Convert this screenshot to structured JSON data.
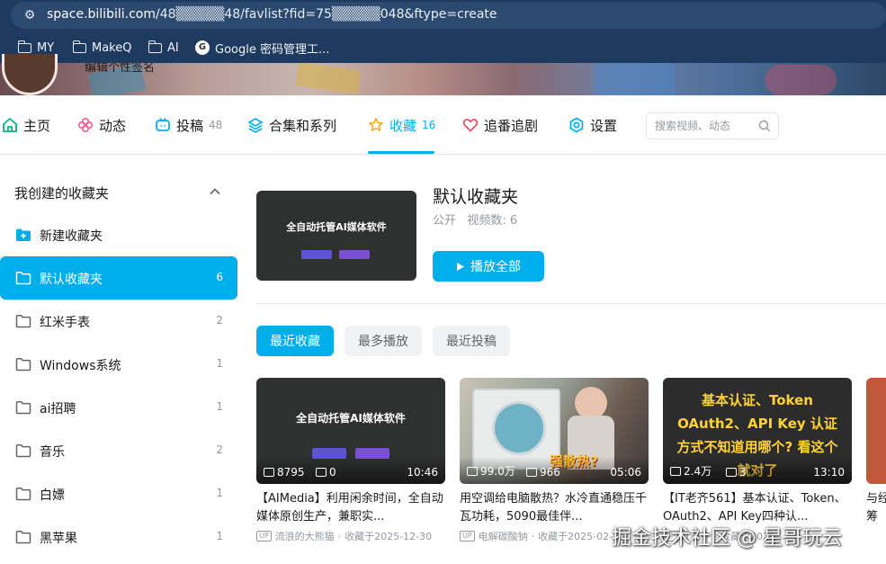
{
  "browser": {
    "url_domain": "space.bilibili.com",
    "url_path": "/48▒▒▒▒▒48/favlist?fid=75▒▒▒▒▒048&ftype=create",
    "bookmarks": [
      {
        "label": "MY",
        "icon": "folder-icon"
      },
      {
        "label": "MakeQ",
        "icon": "folder-icon"
      },
      {
        "label": "AI",
        "icon": "folder-icon"
      },
      {
        "label": "Google 密码管理工...",
        "icon": "google-icon"
      }
    ]
  },
  "profile": {
    "signature": "编辑个性签名"
  },
  "nav": {
    "items": [
      {
        "label": "主页",
        "count": "",
        "icon": "home-icon"
      },
      {
        "label": "动态",
        "count": "",
        "icon": "pinwheel-icon"
      },
      {
        "label": "投稿",
        "count": "48",
        "icon": "tv-icon"
      },
      {
        "label": "合集和系列",
        "count": "",
        "icon": "layers-icon"
      },
      {
        "label": "收藏",
        "count": "16",
        "icon": "star-icon"
      },
      {
        "label": "追番追剧",
        "count": "",
        "icon": "heart-icon"
      },
      {
        "label": "设置",
        "count": "",
        "icon": "gear-icon"
      }
    ],
    "active": "收藏",
    "search_placeholder": "搜索视频、动态"
  },
  "sidebar": {
    "heading": "我创建的收藏夹",
    "new_folder": "新建收藏夹",
    "folders": [
      {
        "label": "默认收藏夹",
        "count": "6",
        "active": true
      },
      {
        "label": "红米手表",
        "count": "2"
      },
      {
        "label": "Windows系统",
        "count": "1"
      },
      {
        "label": "ai招聘",
        "count": "1"
      },
      {
        "label": "音乐",
        "count": "2"
      },
      {
        "label": "白嫖",
        "count": "1"
      },
      {
        "label": "黑苹果",
        "count": "1"
      }
    ]
  },
  "favlist": {
    "title": "默认收藏夹",
    "visibility": "公开",
    "video_count_label": "视频数: 6",
    "play_all": "播放全部",
    "cover_text": "全自动托管AI媒体软件"
  },
  "tabs": [
    "最近收藏",
    "最多播放",
    "最近投稿"
  ],
  "videos": [
    {
      "thumb_text": "全自动托管AI媒体软件",
      "plays": "8795",
      "danmaku": "0",
      "duration": "10:46",
      "title": "【AIMedia】利用闲余时间，全自动媒体原创生产，兼职实...",
      "up_name": "流浪的大熊猫",
      "fav_time": "收藏于2025-12-30"
    },
    {
      "thumb_text": "强散热?",
      "plays": "99.0万",
      "danmaku": "966",
      "duration": "05:06",
      "title": "用空调给电脑散热？水冷直通稳压千瓦功耗，5090最佳伴...",
      "up_name": "电解碳酸钠",
      "fav_time": "收藏于2025-02-..."
    },
    {
      "thumb_text": "基本认证、Token OAuth2、API Key 认证方式不知道用哪个? 看这个就对了",
      "plays": "2.4万",
      "danmaku": "3",
      "duration": "13:10",
      "title": "【IT老齐561】基本认证、Token、OAuth2、API Key四种认...",
      "up_name": "IT老齐",
      "fav_time": "收藏于2025-..."
    },
    {
      "thumb_text": "",
      "plays": "",
      "danmaku": "",
      "duration": "",
      "title": "与经谋筹",
      "up_name": "",
      "fav_time": ""
    }
  ],
  "watermark": "掘金技术社区 @ 星哥玩云",
  "colors": {
    "accent": "#00aeec",
    "browser_chrome": "#1e3a5f",
    "text_primary": "#18191c",
    "text_secondary": "#9499a0"
  }
}
